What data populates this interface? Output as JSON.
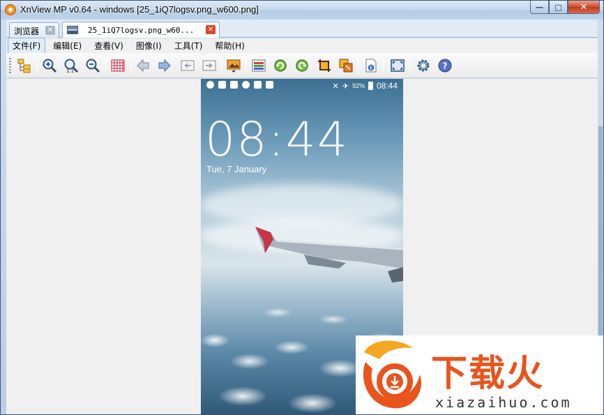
{
  "window": {
    "title": "XnView MP v0.64 - windows [25_1iQ7logsv.png_w600.png]",
    "caption_buttons": {
      "minimize": "—",
      "maximize": "□",
      "close": "✕"
    }
  },
  "tabs": [
    {
      "label": "浏览器",
      "active": false,
      "close": "✕"
    },
    {
      "label": "25_1iQ7logsv.png_w60...",
      "active": true,
      "close": "✕"
    }
  ],
  "menu": [
    {
      "label": "文件(F)",
      "active": true
    },
    {
      "label": "编辑(E)",
      "active": false
    },
    {
      "label": "查看(V)",
      "active": false
    },
    {
      "label": "图像(I)",
      "active": false
    },
    {
      "label": "工具(T)",
      "active": false
    },
    {
      "label": "帮助(H)",
      "active": false
    }
  ],
  "toolbar_icons": [
    "browser-tree-icon",
    "zoom-in-icon",
    "zoom-actual-icon",
    "zoom-out-icon",
    "grid-icon",
    "previous-arrow-icon",
    "next-arrow-icon",
    "first-image-icon",
    "last-image-icon",
    "slideshow-icon",
    "adjust-icon",
    "rotate-left-icon",
    "rotate-right-icon",
    "crop-icon",
    "resize-icon",
    "info-icon",
    "fullscreen-icon",
    "settings-icon",
    "help-icon"
  ],
  "image": {
    "status_time": "08:44",
    "battery": "92%",
    "clock": "08:44",
    "date": "Tue, 7 January"
  },
  "watermark": {
    "text": "下载火",
    "domain": "xiazaihuo.com"
  },
  "colors": {
    "accent": "#e8541c",
    "close_red": "#d9482b"
  }
}
